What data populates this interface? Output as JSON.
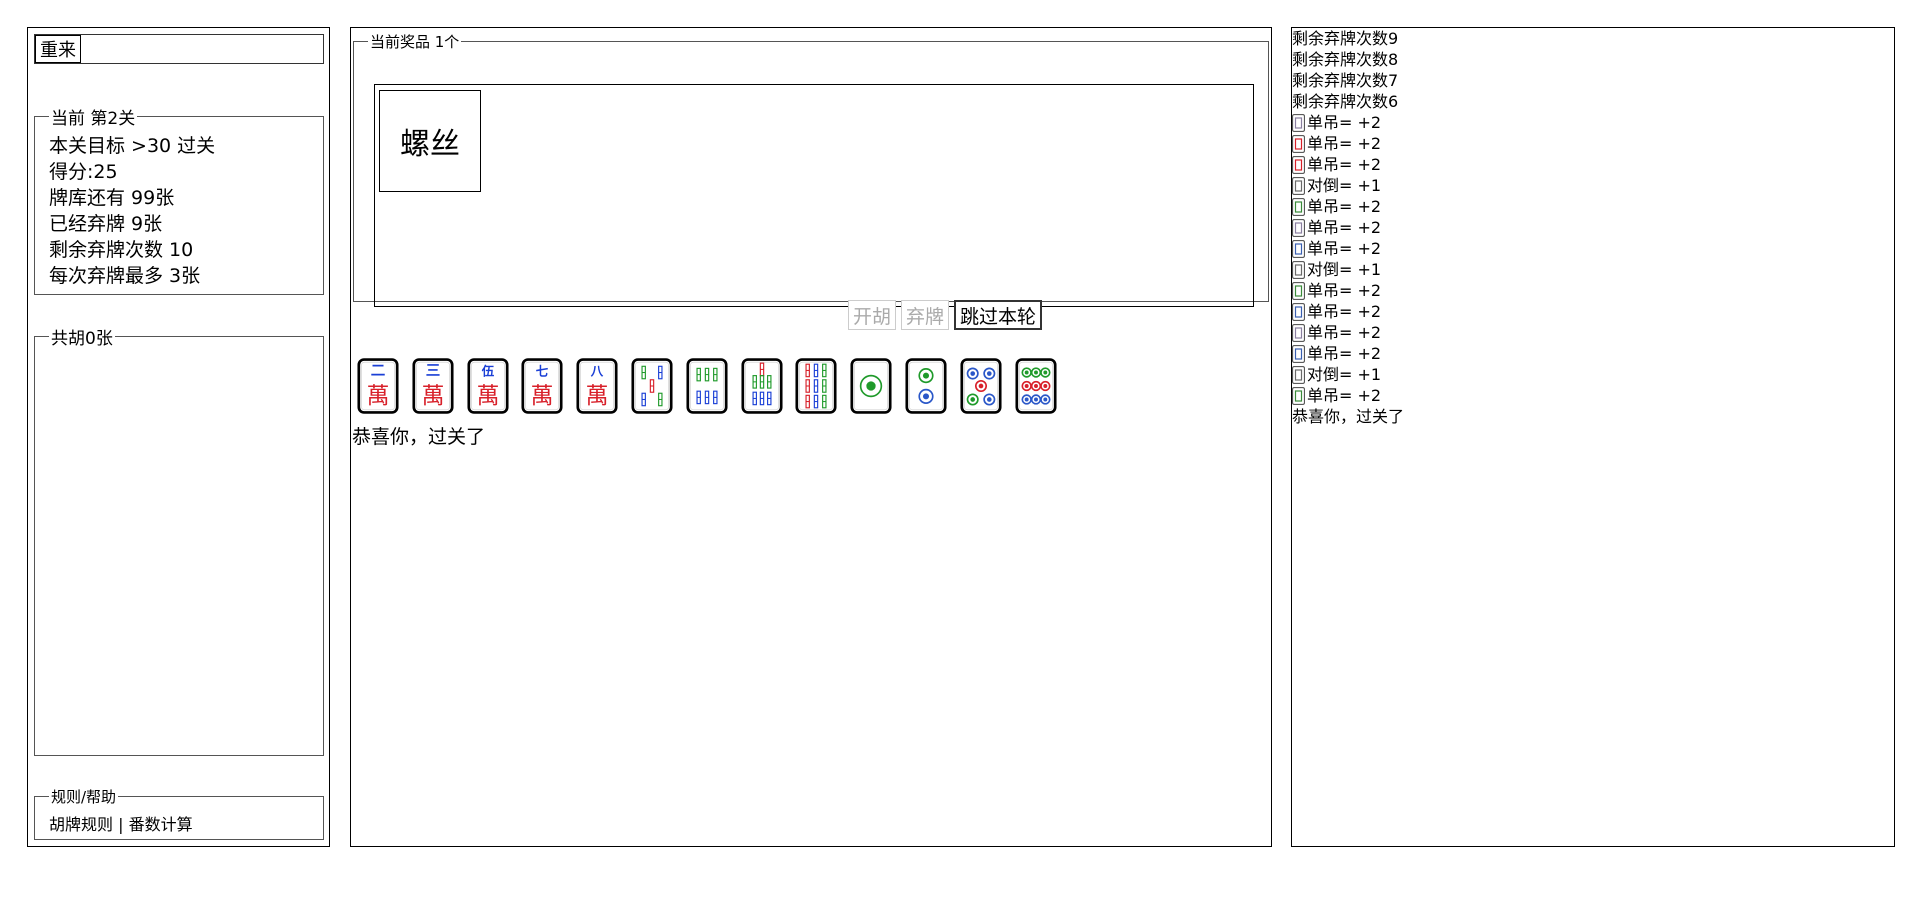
{
  "left": {
    "restart_label": "重来",
    "level_legend": "当前 第2关",
    "stats": [
      "本关目标 >30 过关",
      "得分:25",
      "牌库还有 99张",
      "已经弃牌 9张",
      "剩余弃牌次数 10",
      "每次弃牌最多 3张"
    ],
    "hu_legend": "共胡0张",
    "help_legend": "规则/帮助",
    "help_link_rules": "胡牌规则",
    "help_separator": "|",
    "help_link_fan": "番数计算"
  },
  "prize": {
    "legend": "当前奖品 1个",
    "items": [
      {
        "label": "螺丝"
      }
    ]
  },
  "actions": {
    "hu_label": "开胡",
    "discard_label": "弃牌",
    "skip_label": "跳过本轮"
  },
  "hand": {
    "tiles": [
      {
        "icon": "wan-2-tile",
        "suit": "wan",
        "char": "二"
      },
      {
        "icon": "wan-3-tile",
        "suit": "wan",
        "char": "三"
      },
      {
        "icon": "wan-5-tile",
        "suit": "wan",
        "char": "伍"
      },
      {
        "icon": "wan-7-tile",
        "suit": "wan",
        "char": "七"
      },
      {
        "icon": "wan-8-tile",
        "suit": "wan",
        "char": "八"
      },
      {
        "icon": "bamboo-5-tile",
        "suit": "tiao",
        "n": 5
      },
      {
        "icon": "bamboo-6-tile",
        "suit": "tiao",
        "n": 6
      },
      {
        "icon": "bamboo-7-tile",
        "suit": "tiao",
        "n": 7
      },
      {
        "icon": "bamboo-9-tile",
        "suit": "tiao",
        "n": 9
      },
      {
        "icon": "dot-1-tile",
        "suit": "tong",
        "n": 1
      },
      {
        "icon": "dot-2-tile",
        "suit": "tong",
        "n": 2
      },
      {
        "icon": "dot-5-tile",
        "suit": "tong",
        "n": 5
      },
      {
        "icon": "dot-9-tile",
        "suit": "tong",
        "n": 9
      }
    ]
  },
  "status_message": "恭喜你，过关了",
  "log": [
    {
      "text": "剩余弃牌次数9"
    },
    {
      "text": "剩余弃牌次数8"
    },
    {
      "text": "剩余弃牌次数7"
    },
    {
      "text": "剩余弃牌次数6"
    },
    {
      "text": "单吊= +2",
      "icon": "tile-icon",
      "color": "#8a7fa0"
    },
    {
      "text": "单吊= +2",
      "icon": "tile-icon",
      "color": "#d8202a"
    },
    {
      "text": "单吊= +2",
      "icon": "tile-icon",
      "color": "#d8202a"
    },
    {
      "text": "对倒= +1",
      "icon": "tile-icon",
      "color": "#6a6a6a"
    },
    {
      "text": "单吊= +2",
      "icon": "tile-icon",
      "color": "#3a8a3a"
    },
    {
      "text": "单吊= +2",
      "icon": "tile-icon",
      "color": "#8a7fa0"
    },
    {
      "text": "单吊= +2",
      "icon": "tile-icon",
      "color": "#3a5fb0"
    },
    {
      "text": "对倒= +1",
      "icon": "tile-icon",
      "color": "#6a6a6a"
    },
    {
      "text": "单吊= +2",
      "icon": "tile-icon",
      "color": "#3a8a3a"
    },
    {
      "text": "单吊= +2",
      "icon": "tile-icon",
      "color": "#3a5fb0"
    },
    {
      "text": "单吊= +2",
      "icon": "tile-icon",
      "color": "#8a7fa0"
    },
    {
      "text": "单吊= +2",
      "icon": "tile-icon",
      "color": "#3a5fb0"
    },
    {
      "text": "对倒= +1",
      "icon": "tile-icon",
      "color": "#6a6a6a"
    },
    {
      "text": "单吊= +2",
      "icon": "tile-icon",
      "color": "#3a8a3a"
    },
    {
      "text": "恭喜你，过关了"
    }
  ],
  "colors": {
    "wan_red": "#d8202a",
    "wan_blue": "#1a3fd6",
    "bamboo_green": "#1f9a2a",
    "bamboo_blue": "#1a3fd6",
    "bamboo_red": "#d8202a",
    "dot_blue": "#2a57c8",
    "dot_green": "#1f9a2a",
    "dot_red": "#d8202a"
  }
}
